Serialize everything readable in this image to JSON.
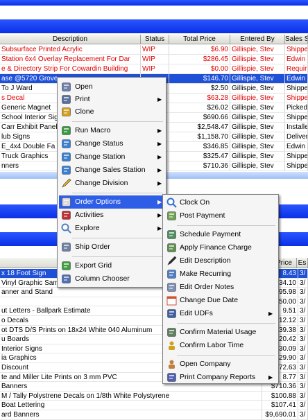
{
  "grid": {
    "columns": [
      "Description",
      "Status",
      "Total Price",
      "Entered By",
      "Sales S"
    ],
    "rows": [
      {
        "desc": "Subsurface Printed Acrylic",
        "status": "WIP",
        "price": "$6.90",
        "by": "Gillispie, Stev",
        "ss": "Shipped",
        "style": "red"
      },
      {
        "desc": "Station 6x4 Overlay Replacement For Dar",
        "status": "WIP",
        "price": "$286.45",
        "by": "Gillispie, Stev",
        "ss": "Edwin Ins",
        "style": "red"
      },
      {
        "desc": "e & Directory Strip For Cowardin Building",
        "status": "WIP",
        "price": "$0.00",
        "by": "Gillispie, Stev",
        "ss": "Requires",
        "style": "red"
      },
      {
        "desc": "ase @5720 Grove",
        "status": "",
        "price": "$146.70",
        "by": "Gillispie, Stev",
        "ss": "Edwin Ins",
        "style": "sel"
      },
      {
        "desc": "To J Ward",
        "status": "",
        "price": "$2.50",
        "by": "Gillispie, Stev",
        "ss": "Shipped",
        "style": ""
      },
      {
        "desc": "s Decal",
        "status": "",
        "price": "$63.28",
        "by": "Gillispie, Stev",
        "ss": "Shipped",
        "style": "red"
      },
      {
        "desc": "Generic Magnet",
        "status": "",
        "price": "$26.02",
        "by": "Gillispie, Stev",
        "ss": "Picked Up",
        "style": ""
      },
      {
        "desc": "School Interior Sig",
        "status": "",
        "price": "$690.66",
        "by": "Gillispie, Stev",
        "ss": "Shipped",
        "style": ""
      },
      {
        "desc": "Carr Exhibit Panel",
        "status": "",
        "price": "$2,548.47",
        "by": "Gillispie, Stev",
        "ss": "Installed",
        "style": ""
      },
      {
        "desc": "lub Signs",
        "status": "",
        "price": "$1,158.70",
        "by": "Gillispie, Stev",
        "ss": "Deliver",
        "style": ""
      },
      {
        "desc": "E_4x4 Double Fa",
        "status": "",
        "price": "$346.85",
        "by": "Gillispie, Stev",
        "ss": "Edwin Ins",
        "style": ""
      },
      {
        "desc": "Truck Graphics",
        "status": "",
        "price": "$325.47",
        "by": "Gillispie, Stev",
        "ss": "Shipped",
        "style": ""
      },
      {
        "desc": "nners",
        "status": "",
        "price": "$710.36",
        "by": "Gillispie, Stev",
        "ss": "Shipped",
        "style": ""
      }
    ]
  },
  "lower_grid": {
    "columns": [
      "Price",
      "Es"
    ],
    "rows": [
      {
        "desc": "x 18 Foot Sign",
        "price": "8.43",
        "e": "3/",
        "sel": true
      },
      {
        "desc": "Vinyl Graphic Sam",
        "price": "34.10",
        "e": "3/"
      },
      {
        "desc": "anner and Stand",
        "price": "95.98",
        "e": "3/"
      },
      {
        "desc": "",
        "price": "50.00",
        "e": "3/"
      },
      {
        "desc": "ut Letters - Ballpark Estimate",
        "price": "9.51",
        "e": "3/"
      },
      {
        "desc": "o Decals",
        "price": "12.12",
        "e": "3/"
      },
      {
        "desc": "ot DTS D/S Prints on 18x24 White 040 Aluminum",
        "price": "39.38",
        "e": "3/"
      },
      {
        "desc": "u Boards",
        "price": "20.42",
        "e": "3/"
      },
      {
        "desc": "Interior Signs",
        "price": "30.09",
        "e": "3/"
      },
      {
        "desc": "ia Graphics",
        "price": "29.90",
        "e": "3/"
      },
      {
        "desc": "Discount",
        "price": "72.63",
        "e": "3/"
      },
      {
        "desc": "te and Miller Lite Prints on 3 mm PVC",
        "price": "8.77",
        "e": "3/"
      },
      {
        "desc": "Banners",
        "price": "$710.36",
        "e": "3/"
      },
      {
        "desc": "M / Tally Polystrene Decals on 1/8th White Polystyrene",
        "price": "$100.88",
        "e": "3/"
      },
      {
        "desc": "Boat Lettering",
        "price": "$107.41",
        "e": "3/"
      },
      {
        "desc": "ard Banners",
        "price": "$9,690.01",
        "e": "3/"
      }
    ]
  },
  "context_menu": {
    "items": [
      {
        "label": "Open",
        "icon": "open-folder-icon"
      },
      {
        "label": "Print",
        "icon": "printer-icon",
        "submenu": true
      },
      {
        "label": "Clone",
        "icon": "clone-icon"
      },
      {
        "label": "Run Macro",
        "icon": "macro-icon",
        "submenu": true
      },
      {
        "label": "Change Status",
        "icon": "status-icon",
        "submenu": true
      },
      {
        "label": "Change Station",
        "icon": "station-icon",
        "submenu": true
      },
      {
        "label": "Change Sales Station",
        "icon": "sales-station-icon",
        "submenu": true
      },
      {
        "label": "Change Division",
        "icon": "pencil-icon",
        "submenu": true
      },
      {
        "label": "Order Options",
        "icon": "order-options-icon",
        "submenu": true,
        "highlighted": true
      },
      {
        "label": "Activities",
        "icon": "activities-icon",
        "submenu": true
      },
      {
        "label": "Explore",
        "icon": "magnifier-icon",
        "submenu": true
      },
      {
        "label": "Ship Order",
        "icon": "ship-icon"
      },
      {
        "label": "Export Grid",
        "icon": "export-icon"
      },
      {
        "label": "Column Chooser",
        "icon": "columns-icon"
      }
    ]
  },
  "submenu": {
    "items": [
      {
        "label": "Clock On",
        "icon": "clock-icon"
      },
      {
        "label": "Post Payment",
        "icon": "payment-icon"
      },
      {
        "label": "Schedule Payment",
        "icon": "schedule-payment-icon"
      },
      {
        "label": "Apply Finance Charge",
        "icon": "finance-icon"
      },
      {
        "label": "Edit Description",
        "icon": "edit-pencil-icon"
      },
      {
        "label": "Make Recurring",
        "icon": "recurring-icon"
      },
      {
        "label": "Edit Order Notes",
        "icon": "notes-icon"
      },
      {
        "label": "Change Due Date",
        "icon": "calendar-icon"
      },
      {
        "label": "Edit UDFs",
        "icon": "udf-icon",
        "submenu": true
      },
      {
        "label": "Confirm Material Usage",
        "icon": "material-icon"
      },
      {
        "label": "Confirm Labor Time",
        "icon": "labor-icon"
      },
      {
        "label": "Open Company",
        "icon": "company-icon"
      },
      {
        "label": "Print Company Reports",
        "icon": "reports-icon",
        "submenu": true
      }
    ]
  },
  "colors": {
    "selection": "#1e50d8",
    "menu_highlight": "#2f5ee6",
    "red_text": "#e00000",
    "blue_bar": "#1b3ef0"
  }
}
